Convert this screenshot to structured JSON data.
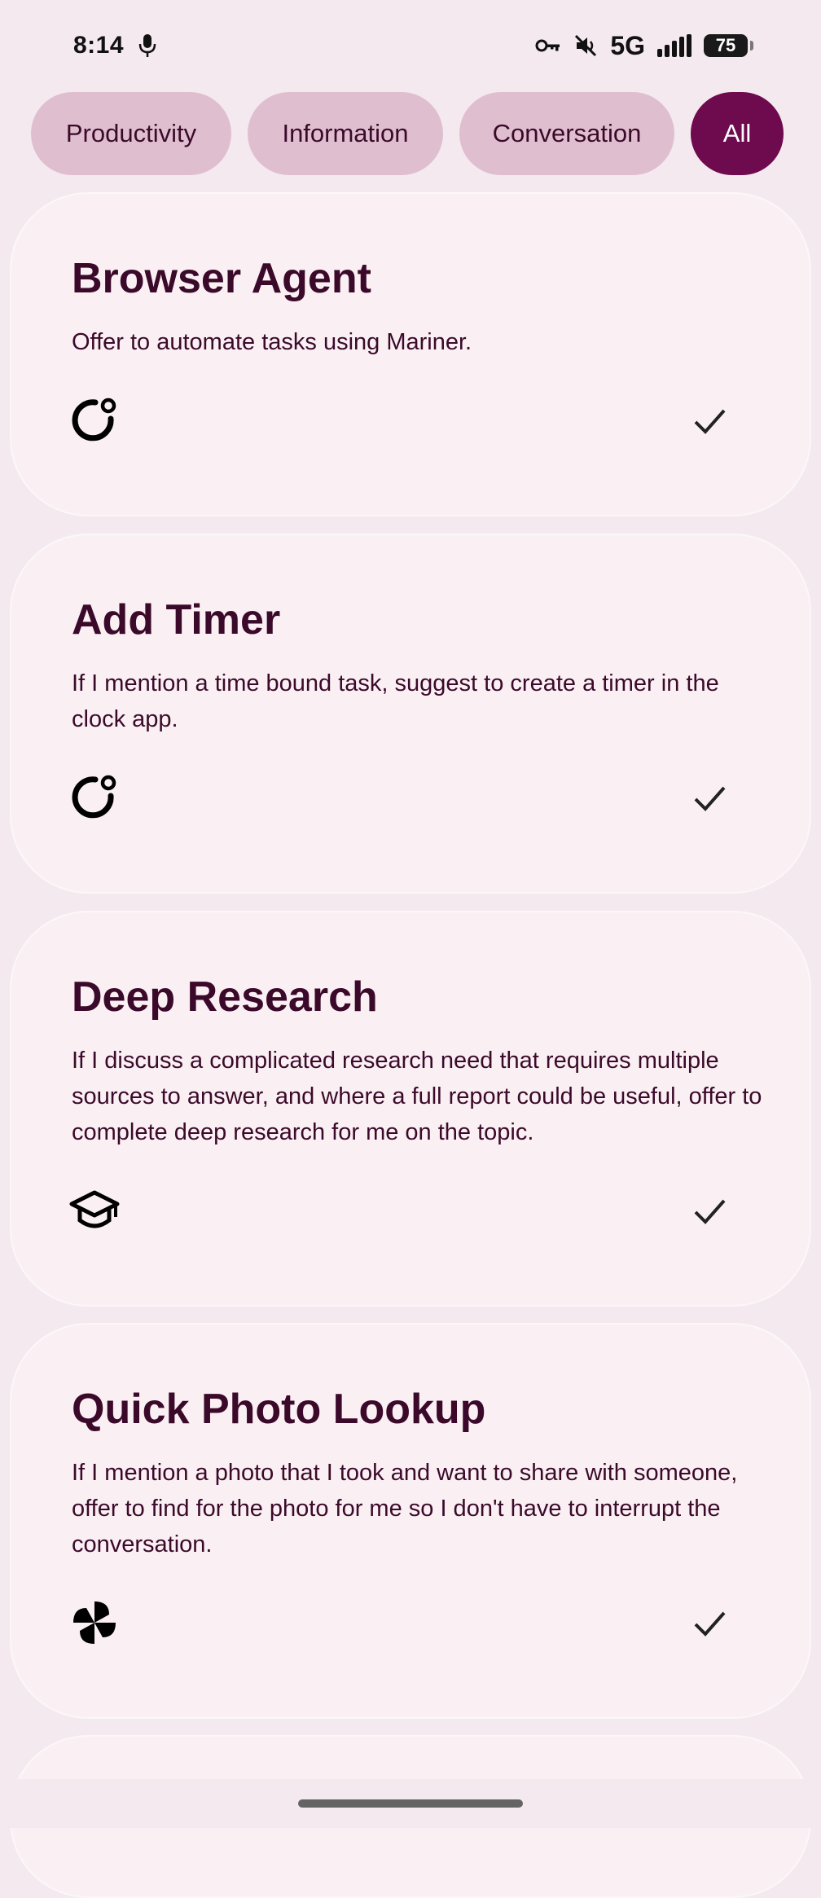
{
  "status_bar": {
    "time": "8:14",
    "network": "5G",
    "battery": "75",
    "icons": [
      "mic-icon",
      "vpn-key-icon",
      "mute-icon",
      "signal-icon",
      "battery-icon"
    ]
  },
  "filters": [
    {
      "label": "Productivity",
      "active": false
    },
    {
      "label": "Information",
      "active": false
    },
    {
      "label": "Conversation",
      "active": false
    },
    {
      "label": "All",
      "active": true
    }
  ],
  "cards": [
    {
      "title": "Browser Agent",
      "description": "Offer to automate tasks using Mariner.",
      "icon": "ring-dot-icon",
      "checked": true
    },
    {
      "title": "Add Timer",
      "description": "If I mention a time bound task, suggest to create a timer in the clock app.",
      "icon": "ring-dot-icon",
      "checked": true
    },
    {
      "title": "Deep Research",
      "description": "If I discuss a complicated research need that requires multiple sources to answer, and where a full report could be useful, offer to complete deep research for me on the topic.",
      "icon": "graduation-cap-icon",
      "checked": true
    },
    {
      "title": "Quick Photo Lookup",
      "description": "If I mention a photo that I took and want to share with someone, offer to find for the photo for me so I don't have to interrupt the conversation.",
      "icon": "pinwheel-icon",
      "checked": true
    }
  ],
  "colors": {
    "background": "#f4e9ee",
    "card": "#faf0f3",
    "chip": "#dfbfcf",
    "chip_active": "#6e0a4e",
    "text": "#3b0a2a"
  }
}
